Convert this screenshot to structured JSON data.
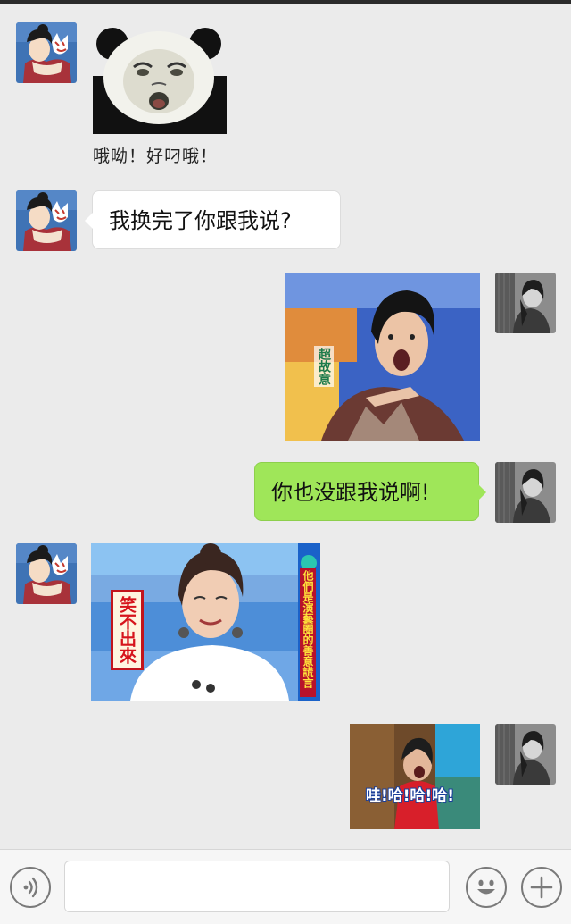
{
  "colors": {
    "background": "#ebebeb",
    "sent_bubble": "#9fe659",
    "received_bubble": "#ffffff",
    "input_bar": "#f6f6f6"
  },
  "messages": [
    {
      "side": "left",
      "kind": "sticker",
      "icon": "panda-meme-sticker",
      "caption": "哦呦！好叼哦！"
    },
    {
      "side": "left",
      "kind": "text",
      "text": "我换完了你跟我说?"
    },
    {
      "side": "right",
      "kind": "image",
      "icon": "shocked-woman-tv-still",
      "caption": "超故意"
    },
    {
      "side": "right",
      "kind": "text",
      "text": "你也没跟我说啊!"
    },
    {
      "side": "left",
      "kind": "image",
      "icon": "smiling-woman-tv-still",
      "caption": "笑不出來",
      "side_caption": "他們是演藝圈的善意謊言"
    },
    {
      "side": "right",
      "kind": "image",
      "icon": "laughing-woman-tv-still",
      "caption": "哇!哈!哈!哈!"
    }
  ],
  "contacts": {
    "left_avatar_icon": "cartoon-woman-fox-avatar",
    "right_avatar_icon": "grayscale-woman-photo-avatar"
  },
  "input_bar": {
    "voice_icon": "voice-icon",
    "emoji_icon": "emoji-icon",
    "more_icon": "plus-icon",
    "text_value": ""
  }
}
